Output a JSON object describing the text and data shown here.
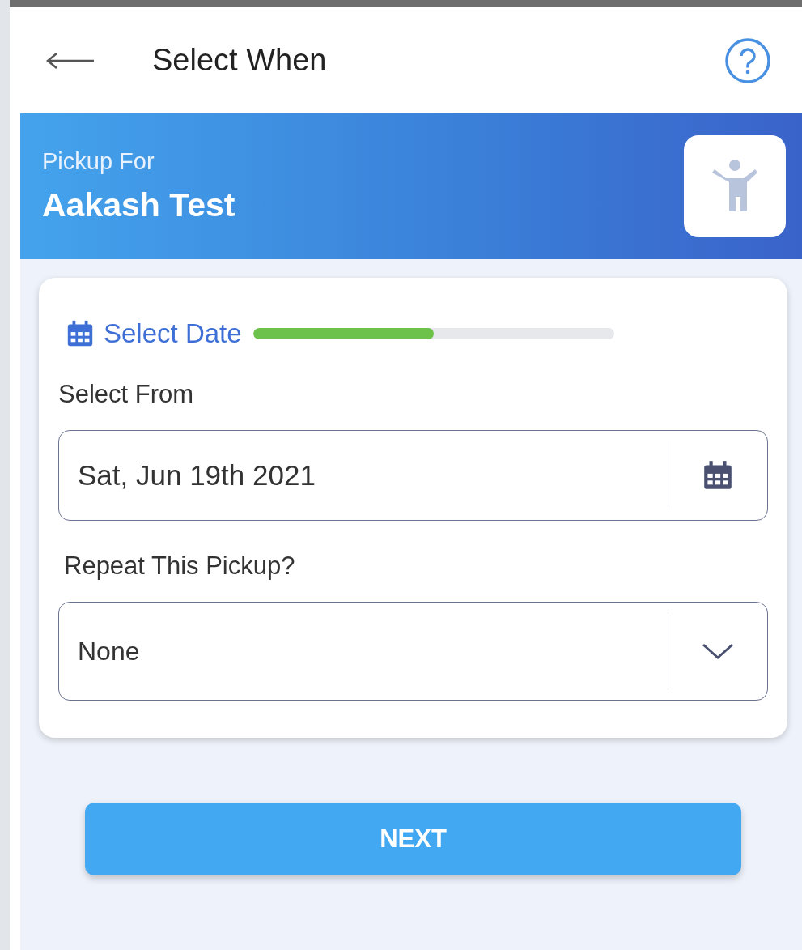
{
  "header": {
    "title": "Select When"
  },
  "banner": {
    "label": "Pickup For",
    "name": "Aakash Test"
  },
  "card": {
    "step": {
      "label": "Select Date",
      "level": 0.5
    },
    "fields": [
      {
        "kind": "date",
        "label": "Select From",
        "value": "Sat, Jun 19th 2021"
      },
      {
        "kind": "select",
        "label": "Repeat This Pickup?",
        "value": "None"
      }
    ]
  },
  "button": {
    "label": "NEXT"
  }
}
